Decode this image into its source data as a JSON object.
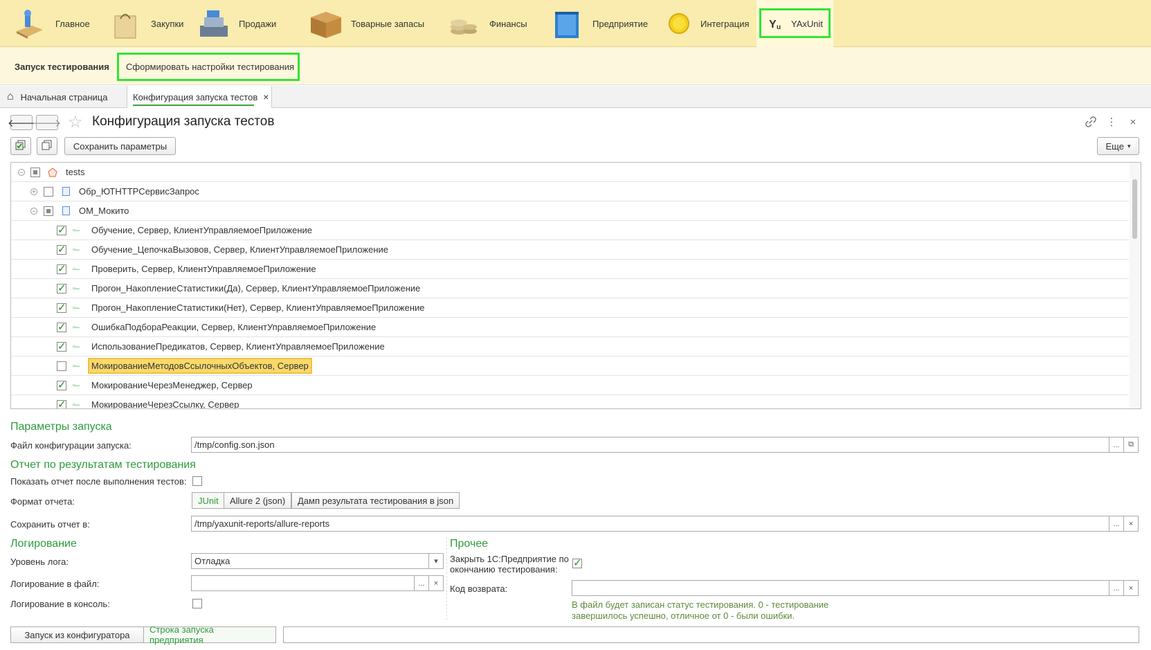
{
  "sections": [
    {
      "label": "Главное",
      "icon": "main-desk-icon"
    },
    {
      "label": "Закупки",
      "icon": "shopping-bag-icon"
    },
    {
      "label": "Продажи",
      "icon": "cash-register-icon"
    },
    {
      "label": "Товарные запасы",
      "icon": "box-icon"
    },
    {
      "label": "Финансы",
      "icon": "coins-icon"
    },
    {
      "label": "Предприятие",
      "icon": "building-icon"
    },
    {
      "label": "Интеграция",
      "icon": "circle-icon"
    },
    {
      "label": "YAxUnit",
      "icon": "yaxunit-logo-icon"
    }
  ],
  "subbar": {
    "title": "Запуск тестирования",
    "command": "Сформировать настройки тестирования"
  },
  "tabs": {
    "home": "Начальная страница",
    "current": "Конфигурация запуска тестов",
    "close": "×"
  },
  "form": {
    "title": "Конфигурация запуска тестов",
    "save_params": "Сохранить параметры",
    "more": "Еще"
  },
  "tree": {
    "root": "tests",
    "groups": [
      {
        "label": "Обр_ЮТHTTPСервисЗапрос"
      },
      {
        "label": "ОМ_Мокито"
      }
    ],
    "items": [
      {
        "label": "Обучение, Сервер, КлиентУправляемоеПриложение",
        "checked": true
      },
      {
        "label": "Обучение_ЦепочкаВызовов, Сервер, КлиентУправляемоеПриложение",
        "checked": true
      },
      {
        "label": "Проверить, Сервер, КлиентУправляемоеПриложение",
        "checked": true
      },
      {
        "label": "Прогон_НакоплениеСтатистики(Да), Сервер, КлиентУправляемоеПриложение",
        "checked": true
      },
      {
        "label": "Прогон_НакоплениеСтатистики(Нет), Сервер, КлиентУправляемоеПриложение",
        "checked": true
      },
      {
        "label": "ОшибкаПодбораРеакции, Сервер, КлиентУправляемоеПриложение",
        "checked": true
      },
      {
        "label": "ИспользованиеПредикатов, Сервер, КлиентУправляемоеПриложение",
        "checked": true
      },
      {
        "label": "МокированиеМетодовСсылочныхОбъектов, Сервер",
        "checked": false
      },
      {
        "label": "МокированиеЧерезМенеджер, Сервер",
        "checked": true
      },
      {
        "label": "МокированиеЧерезСсылку, Сервер",
        "checked": true
      }
    ]
  },
  "launch": {
    "section": "Параметры запуска",
    "config_label": "Файл конфигурации запуска:",
    "config_value": "/tmp/config.son.json"
  },
  "report": {
    "section": "Отчет по результатам тестирования",
    "show_label": "Показать отчет после выполнения тестов:",
    "format_label": "Формат отчета:",
    "formats": [
      "JUnit",
      "Allure 2 (json)",
      "Дамп результата тестирования в json"
    ],
    "selected_format": "JUnit",
    "save_label": "Сохранить отчет в:",
    "save_value": "/tmp/yaxunit-reports/allure-reports"
  },
  "logging": {
    "section": "Логирование",
    "level_label": "Уровень лога:",
    "level_value": "Отладка",
    "file_label": "Логирование в файл:",
    "file_value": "",
    "console_label": "Логирование в консоль:"
  },
  "other": {
    "section": "Прочее",
    "close_label_1": "Закрыть 1С:Предприятие по",
    "close_label_2": "окончанию тестирования:",
    "return_label": "Код возврата:",
    "return_value": "",
    "note_1": "В файл будет записан статус  тестирования. 0 - тестирование",
    "note_2": "завершилось успешно, отличное от 0 - были ошибки."
  },
  "bottom": {
    "from_configurator": "Запуск из конфигуратора",
    "launch_string": "Строка запуска предприятия",
    "launch_value": ""
  },
  "glyphs": {
    "dots": "...",
    "clear": "×",
    "open": "⧉",
    "caret": "▾",
    "star": "☆",
    "link": "🔗",
    "kebab": "⋮",
    "close": "×",
    "back": "🡐",
    "fwd": "🡒",
    "home": "⌂",
    "leaf": "▫–"
  }
}
